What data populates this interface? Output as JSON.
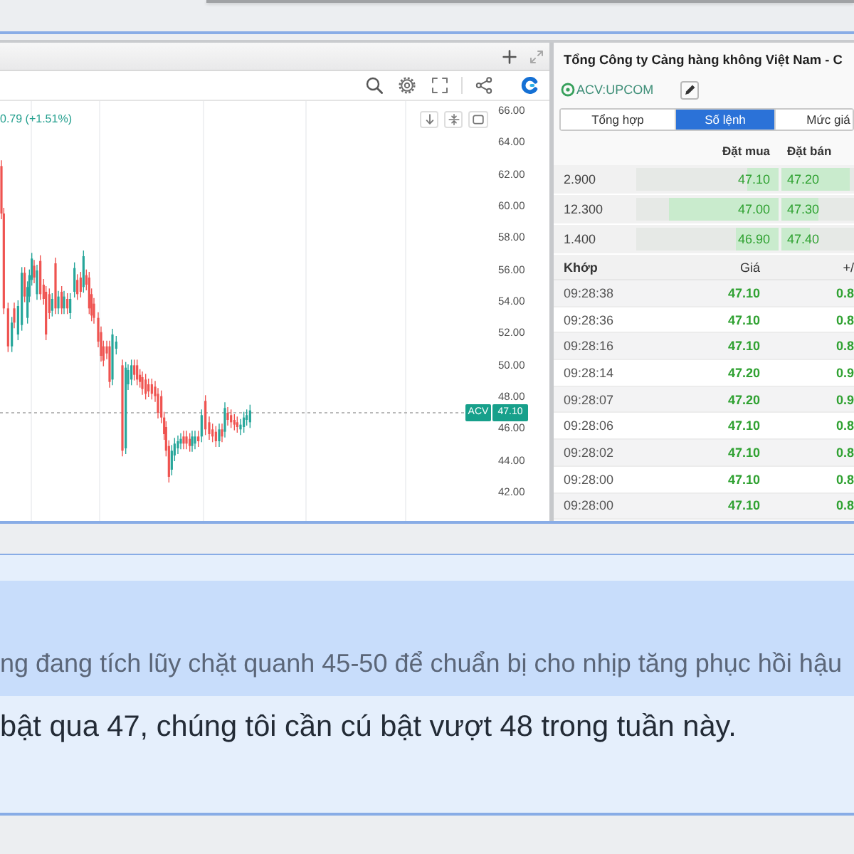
{
  "chart_window": {
    "legend": "0.79 (+1.51%)",
    "price_axis": [
      "66.00",
      "64.00",
      "62.00",
      "60.00",
      "58.00",
      "56.00",
      "54.00",
      "52.00",
      "50.00",
      "48.00",
      "46.00",
      "44.00",
      "42.00"
    ],
    "price_tag": {
      "symbol": "ACV",
      "price": "47.10"
    }
  },
  "quote_panel": {
    "company": "Tổng Công ty Cảng hàng không Việt Nam - C",
    "ticker": "ACV:UPCOM",
    "tabs": [
      {
        "label": "Tổng hợp",
        "selected": false
      },
      {
        "label": "Số lệnh",
        "selected": true
      },
      {
        "label": "Mức giá",
        "selected": false
      }
    ],
    "order_book": {
      "columns": [
        "Đặt mua",
        "Đặt bán"
      ],
      "rows": [
        {
          "volume": "2.900",
          "bid": {
            "price": "47.10",
            "level": 0.22
          },
          "ask": {
            "price": "47.20",
            "level": 0.94
          }
        },
        {
          "volume": "12.300",
          "bid": {
            "price": "47.00",
            "level": 0.77
          },
          "ask": {
            "price": "47.30",
            "level": 0.5
          }
        },
        {
          "volume": "1.400",
          "bid": {
            "price": "46.90",
            "level": 0.3
          },
          "ask": {
            "price": "47.40",
            "level": 0.4
          }
        }
      ]
    },
    "trades": {
      "columns": [
        "Khớp",
        "Giá",
        "+/"
      ],
      "rows": [
        {
          "time": "09:28:38",
          "price": "47.10",
          "change": "0.8"
        },
        {
          "time": "09:28:36",
          "price": "47.10",
          "change": "0.8"
        },
        {
          "time": "09:28:16",
          "price": "47.10",
          "change": "0.8"
        },
        {
          "time": "09:28:14",
          "price": "47.20",
          "change": "0.9"
        },
        {
          "time": "09:28:07",
          "price": "47.20",
          "change": "0.9"
        },
        {
          "time": "09:28:06",
          "price": "47.10",
          "change": "0.8"
        },
        {
          "time": "09:28:02",
          "price": "47.10",
          "change": "0.8"
        },
        {
          "time": "09:28:00",
          "price": "47.10",
          "change": "0.8"
        },
        {
          "time": "09:28:00",
          "price": "47.10",
          "change": "0.8"
        }
      ]
    }
  },
  "article": {
    "quote": "ng đang tích lũy chặt quanh 45-50 để chuẩn bị cho nhịp tăng phục hồi hậu",
    "paragraph": "bật qua 47, chúng tôi cần cú bật vượt 48 trong tuần này."
  }
}
